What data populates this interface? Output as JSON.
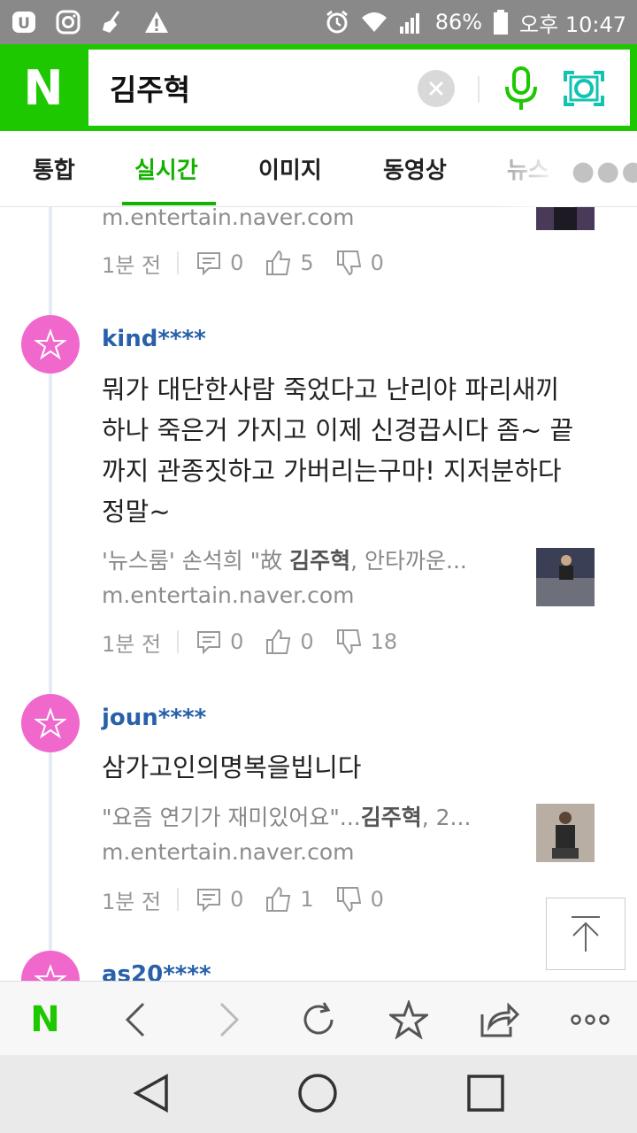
{
  "status": {
    "battery": "86%",
    "time": "오후 10:47"
  },
  "search": {
    "query": "김주혁",
    "logo": "N"
  },
  "tabs": [
    {
      "label": "통합"
    },
    {
      "label": "실시간",
      "active": true
    },
    {
      "label": "이미지"
    },
    {
      "label": "동영상"
    },
    {
      "label": "뉴스"
    }
  ],
  "top_partial": {
    "url": "m.entertain.naver.com",
    "time": "1분 전",
    "comments": "0",
    "likes": "5",
    "dislikes": "0"
  },
  "posts": [
    {
      "user": "kind****",
      "lines": [
        "뭐가 대단한사람 죽었다고 난리야 파리새끼",
        "하나 죽은거 가지고 이제 신경끕시다 좀~ 끝",
        "까지 관종짓하고 가버리는구마! 지저분하다",
        "정말~"
      ],
      "link_pre": "'뉴스룸' 손석희 \"故 ",
      "link_bold": "김주혁",
      "link_post": ", 안타까운...",
      "url": "m.entertain.naver.com",
      "time": "1분 전",
      "comments": "0",
      "likes": "0",
      "dislikes": "18"
    },
    {
      "user": "joun****",
      "lines": [
        "삼가고인의명복을빕니다"
      ],
      "link_pre": "\"요즘 연기가 재미있어요\"...",
      "link_bold": "김주혁",
      "link_post": ", 2...",
      "url": "m.entertain.naver.com",
      "time": "1분 전",
      "comments": "0",
      "likes": "1",
      "dislikes": "0"
    },
    {
      "user": "as20****"
    }
  ],
  "colors": {
    "naver_green": "#1ec800",
    "active_tab": "#14b200",
    "avatar_pink": "#f168cd",
    "username_blue": "#2860aa"
  }
}
